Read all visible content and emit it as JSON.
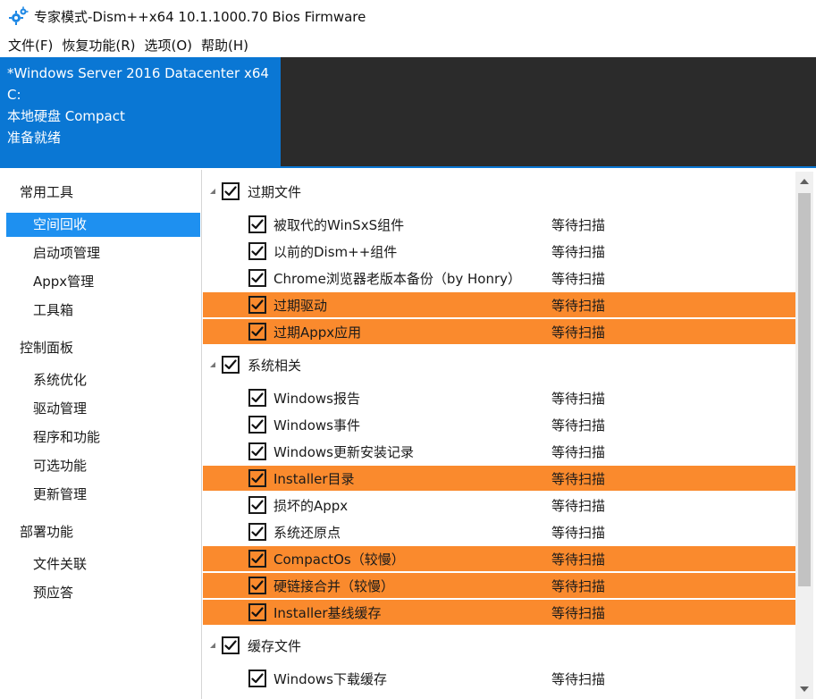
{
  "window": {
    "title": "专家模式-Dism++x64 10.1.1000.70 Bios Firmware",
    "icon": "gears-icon"
  },
  "menu": [
    {
      "label": "文件(F)"
    },
    {
      "label": "恢复功能(R)"
    },
    {
      "label": "选项(O)"
    },
    {
      "label": "帮助(H)"
    }
  ],
  "info": {
    "os": "*Windows Server 2016 Datacenter x64",
    "drive": "C:",
    "disk": "本地硬盘 Compact",
    "status": "准备就绪"
  },
  "sidebar": {
    "sections": [
      {
        "label": "常用工具",
        "items": [
          {
            "label": "空间回收",
            "selected": true
          },
          {
            "label": "启动项管理",
            "selected": false
          },
          {
            "label": "Appx管理",
            "selected": false
          },
          {
            "label": "工具箱",
            "selected": false
          }
        ]
      },
      {
        "label": "控制面板",
        "items": [
          {
            "label": "系统优化",
            "selected": false
          },
          {
            "label": "驱动管理",
            "selected": false
          },
          {
            "label": "程序和功能",
            "selected": false
          },
          {
            "label": "可选功能",
            "selected": false
          },
          {
            "label": "更新管理",
            "selected": false
          }
        ]
      },
      {
        "label": "部署功能",
        "items": [
          {
            "label": "文件关联",
            "selected": false
          },
          {
            "label": "预应答",
            "selected": false
          }
        ]
      }
    ]
  },
  "groups": [
    {
      "label": "过期文件",
      "checked": true,
      "items": [
        {
          "label": "被取代的WinSxS组件",
          "status": "等待扫描",
          "checked": true,
          "highlight": false
        },
        {
          "label": "以前的Dism++组件",
          "status": "等待扫描",
          "checked": true,
          "highlight": false
        },
        {
          "label": "Chrome浏览器老版本备份（by Honry）",
          "status": "等待扫描",
          "checked": true,
          "highlight": false
        },
        {
          "label": "过期驱动",
          "status": "等待扫描",
          "checked": true,
          "highlight": true
        },
        {
          "label": "过期Appx应用",
          "status": "等待扫描",
          "checked": true,
          "highlight": true
        }
      ]
    },
    {
      "label": "系统相关",
      "checked": true,
      "items": [
        {
          "label": "Windows报告",
          "status": "等待扫描",
          "checked": true,
          "highlight": false
        },
        {
          "label": "Windows事件",
          "status": "等待扫描",
          "checked": true,
          "highlight": false
        },
        {
          "label": "Windows更新安装记录",
          "status": "等待扫描",
          "checked": true,
          "highlight": false
        },
        {
          "label": "Installer目录",
          "status": "等待扫描",
          "checked": true,
          "highlight": true
        },
        {
          "label": "损坏的Appx",
          "status": "等待扫描",
          "checked": true,
          "highlight": false
        },
        {
          "label": "系统还原点",
          "status": "等待扫描",
          "checked": true,
          "highlight": false
        },
        {
          "label": "CompactOs（较慢）",
          "status": "等待扫描",
          "checked": true,
          "highlight": true
        },
        {
          "label": "硬链接合并（较慢）",
          "status": "等待扫描",
          "checked": true,
          "highlight": true
        },
        {
          "label": "Installer基线缓存",
          "status": "等待扫描",
          "checked": true,
          "highlight": true
        }
      ]
    },
    {
      "label": "缓存文件",
      "checked": true,
      "items": [
        {
          "label": "Windows下载缓存",
          "status": "等待扫描",
          "checked": true,
          "highlight": false
        }
      ]
    }
  ],
  "colors": {
    "accent_blue": "#0a77d4",
    "selected_blue": "#1e90f0",
    "highlight_orange": "#fa8a2d",
    "dark_panel": "#2b2b2b"
  }
}
